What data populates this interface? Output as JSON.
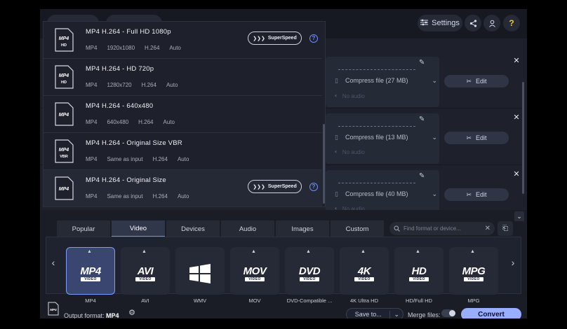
{
  "topbar": {
    "settings_label": "Settings",
    "help_label": "?"
  },
  "format_list": [
    {
      "name": "MP4 H.264 - Full HD 1080p",
      "container": "MP4",
      "resolution": "1920x1080",
      "codec": "H.264",
      "audio": "Auto",
      "superspeed": true,
      "icon_main": "MP4",
      "icon_sub": "HD"
    },
    {
      "name": "MP4 H.264 - HD 720p",
      "container": "MP4",
      "resolution": "1280x720",
      "codec": "H.264",
      "audio": "Auto",
      "superspeed": false,
      "icon_main": "MP4",
      "icon_sub": "HD"
    },
    {
      "name": "MP4 H.264 - 640x480",
      "container": "MP4",
      "resolution": "640x480",
      "codec": "H.264",
      "audio": "Auto",
      "superspeed": false,
      "icon_main": "MP4",
      "icon_sub": ""
    },
    {
      "name": "MP4 H.264 - Original Size VBR",
      "container": "MP4",
      "resolution": "Same as input",
      "codec": "H.264",
      "audio": "Auto",
      "superspeed": false,
      "icon_main": "MP4",
      "icon_sub": "VBR"
    },
    {
      "name": "MP4 H.264 - Original Size",
      "container": "MP4",
      "resolution": "Same as input",
      "codec": "H.264",
      "audio": "Auto",
      "superspeed": true,
      "icon_main": "MP4",
      "icon_sub": ""
    }
  ],
  "superspeed_label": "SuperSpeed",
  "files": [
    {
      "compress": "Compress file (27 MB)",
      "audio": "No audio",
      "edit_label": "Edit"
    },
    {
      "compress": "Compress file (13 MB)",
      "audio": "No audio",
      "edit_label": "Edit"
    },
    {
      "compress": "Compress file (40 MB)",
      "audio": "No audio",
      "edit_label": "Edit"
    }
  ],
  "category_tabs": [
    "Popular",
    "Video",
    "Devices",
    "Audio",
    "Images",
    "Custom"
  ],
  "active_category": "Video",
  "search": {
    "placeholder": "Find format or device..."
  },
  "formats": [
    {
      "logo": "MP4",
      "sub": "VIDEO",
      "label": "MP4",
      "active": true
    },
    {
      "logo": "AVI",
      "sub": "VIDEO",
      "label": "AVI",
      "active": false
    },
    {
      "logo": "WMV",
      "sub": "",
      "label": "WMV",
      "active": false,
      "icon": "windows-icon"
    },
    {
      "logo": "MOV",
      "sub": "VIDEO",
      "label": "MOV",
      "active": false
    },
    {
      "logo": "DVD",
      "sub": "VIDEO",
      "label": "DVD-Compatible ...",
      "active": false
    },
    {
      "logo": "4K",
      "sub": "VIDEO",
      "label": "4K Ultra HD",
      "active": false
    },
    {
      "logo": "HD",
      "sub": "VIDEO",
      "label": "HD/Full HD",
      "active": false
    },
    {
      "logo": "MPG",
      "sub": "VIDEO",
      "label": "MPG",
      "active": false
    }
  ],
  "footer": {
    "output_format_label": "Output format:",
    "output_format_value": "MP4",
    "save_to_label": "Save to...",
    "merge_label": "Merge files:",
    "convert_label": "Convert"
  },
  "colors": {
    "accent": "#9aaeff",
    "active_tile": "#3a4670",
    "help": "#f0c63c"
  }
}
